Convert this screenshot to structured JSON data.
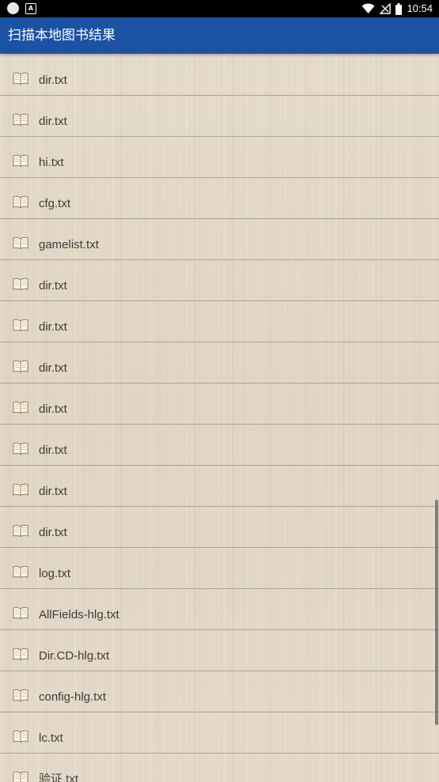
{
  "status_bar": {
    "time": "10:54",
    "icons": [
      "notification-dot-icon",
      "app-a-icon",
      "wifi-icon",
      "no-signal-icon",
      "battery-icon"
    ]
  },
  "app_bar": {
    "title": "扫描本地图书结果"
  },
  "files": [
    {
      "name": "dir.txt",
      "icon": "book-icon"
    },
    {
      "name": "dir.txt",
      "icon": "book-icon"
    },
    {
      "name": "hi.txt",
      "icon": "book-icon"
    },
    {
      "name": "cfg.txt",
      "icon": "book-icon"
    },
    {
      "name": "gamelist.txt",
      "icon": "book-icon"
    },
    {
      "name": "dir.txt",
      "icon": "book-icon"
    },
    {
      "name": "dir.txt",
      "icon": "book-icon"
    },
    {
      "name": "dir.txt",
      "icon": "book-icon"
    },
    {
      "name": "dir.txt",
      "icon": "book-icon"
    },
    {
      "name": "dir.txt",
      "icon": "book-icon"
    },
    {
      "name": "dir.txt",
      "icon": "book-icon"
    },
    {
      "name": "dir.txt",
      "icon": "book-icon"
    },
    {
      "name": "log.txt",
      "icon": "book-icon"
    },
    {
      "name": "AllFields-hlg.txt",
      "icon": "book-icon"
    },
    {
      "name": "Dir.CD-hlg.txt",
      "icon": "book-icon"
    },
    {
      "name": "config-hlg.txt",
      "icon": "book-icon"
    },
    {
      "name": "lc.txt",
      "icon": "book-icon"
    },
    {
      "name": "验证.txt",
      "icon": "book-icon"
    }
  ],
  "colors": {
    "app_bar": "#1b52a4",
    "background": "#e3d7c6",
    "divider": "#a8a39c",
    "text": "#3d3d3d"
  }
}
